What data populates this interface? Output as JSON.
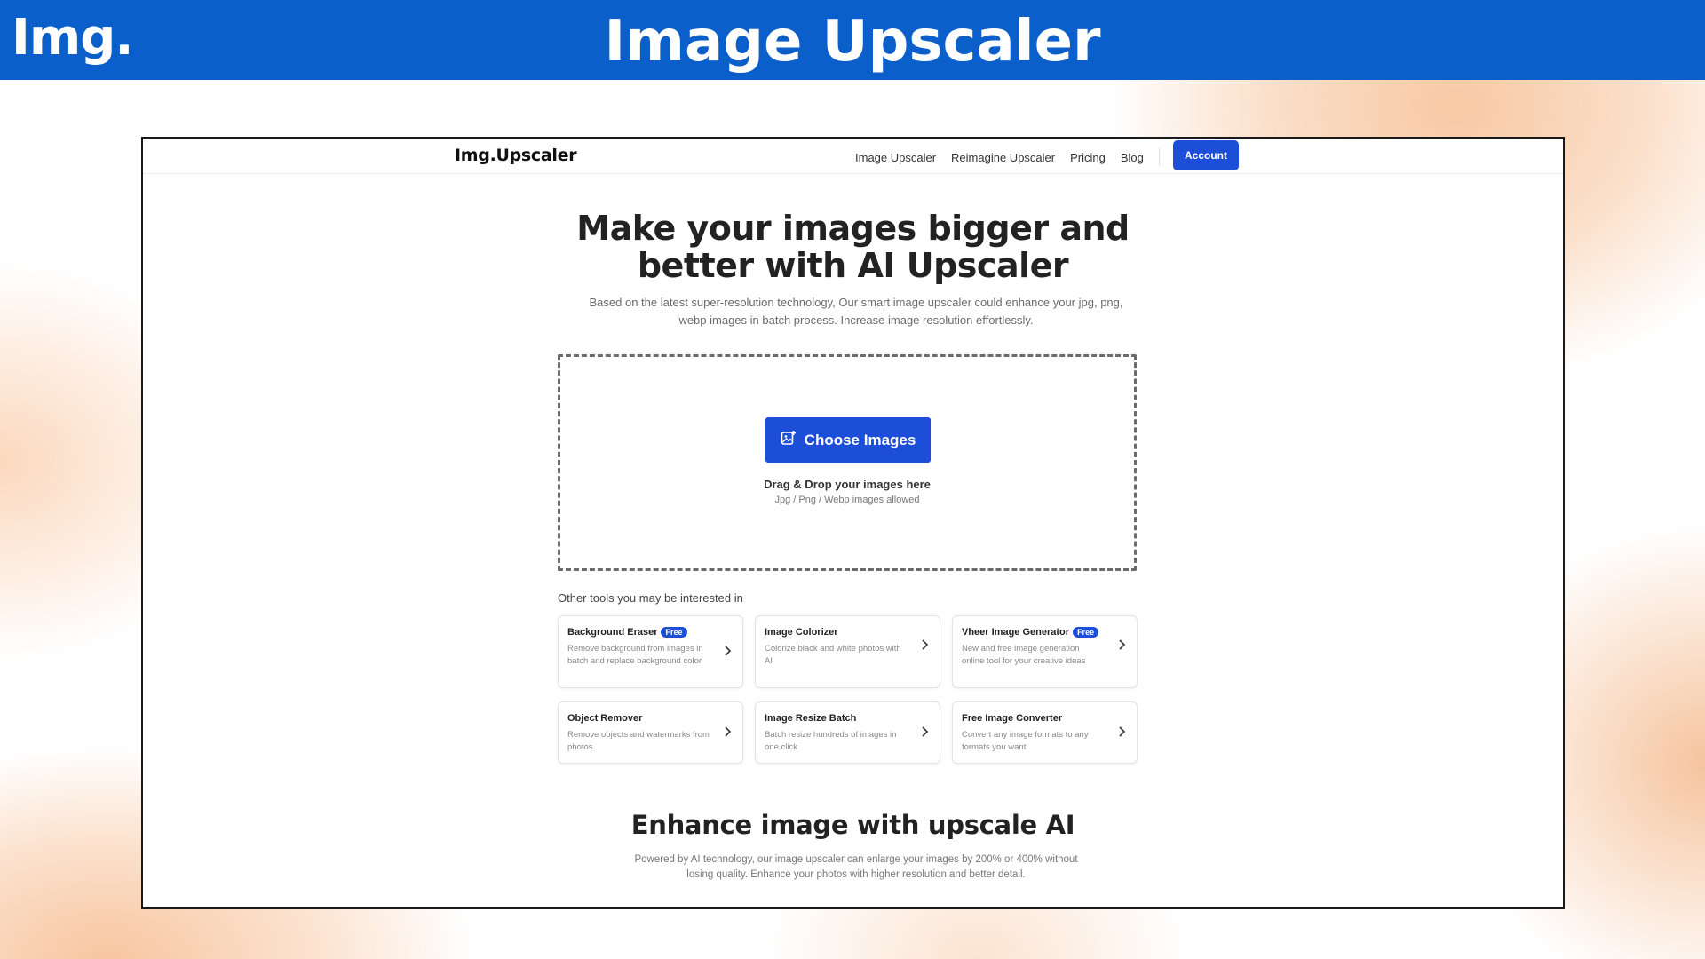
{
  "banner": {
    "logo": "Img.",
    "title": "Image Upscaler"
  },
  "nav": {
    "logo": "Img.Upscaler",
    "links": [
      "Image Upscaler",
      "Reimagine Upscaler",
      "Pricing",
      "Blog"
    ],
    "account_label": "Account"
  },
  "hero": {
    "title_line1": "Make your images bigger and",
    "title_line2": "better with AI Upscaler",
    "subtitle_line1": "Based on the latest super-resolution technology, Our smart image upscaler could enhance your jpg, png,",
    "subtitle_line2": "webp images in batch process. Increase image resolution effortlessly."
  },
  "dropzone": {
    "button_label": "Choose Images",
    "button_icon": "image-add-icon",
    "drag_text": "Drag & Drop your images here",
    "allowed_text": "Jpg / Png / Webp images allowed"
  },
  "tools": {
    "heading": "Other tools you may be interested in",
    "free_label": "Free",
    "items": [
      {
        "title": "Background Eraser",
        "free": true,
        "desc": "Remove background from images in batch and replace background color"
      },
      {
        "title": "Image Colorizer",
        "free": false,
        "desc": "Colorize black and white photos with AI"
      },
      {
        "title": "Vheer Image Generator",
        "free": true,
        "desc": "New and free image generation online tool for your creative ideas"
      },
      {
        "title": "Object Remover",
        "free": false,
        "desc": "Remove objects and watermarks from photos"
      },
      {
        "title": "Image Resize Batch",
        "free": false,
        "desc": "Batch resize hundreds of images in one click"
      },
      {
        "title": "Free Image Converter",
        "free": false,
        "desc": "Convert any image formats to any formats you want"
      }
    ]
  },
  "section": {
    "title": "Enhance image with upscale AI",
    "sub_line1": "Powered by AI technology, our image upscaler can enlarge your images by 200% or 400% without",
    "sub_line2": "losing quality. Enhance your photos with higher resolution and better detail."
  },
  "colors": {
    "banner": "#0b5fca",
    "accent": "#1d4ed8"
  }
}
